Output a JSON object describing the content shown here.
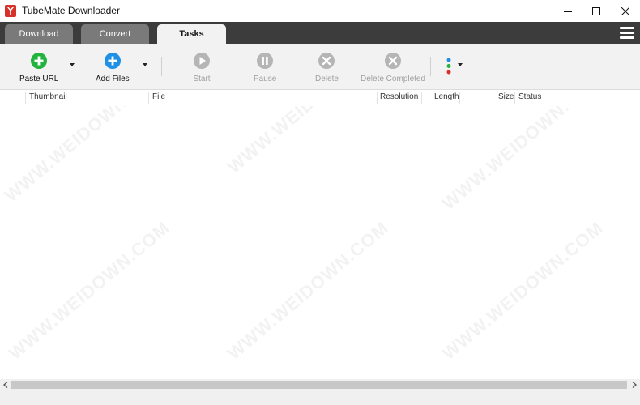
{
  "window": {
    "title": "TubeMate Downloader",
    "controls": {
      "minimize": "minimize-icon",
      "maximize": "maximize-icon",
      "close": "close-icon"
    }
  },
  "tabs": [
    {
      "label": "Download",
      "active": false
    },
    {
      "label": "Convert",
      "active": false
    },
    {
      "label": "Tasks",
      "active": true
    }
  ],
  "toolbar": {
    "paste_url": "Paste URL",
    "add_files": "Add Files",
    "start": "Start",
    "pause": "Pause",
    "delete": "Delete",
    "delete_completed": "Delete Completed"
  },
  "columns": [
    "Thumbnail",
    "File",
    "Resolution",
    "Length",
    "Size",
    "Status"
  ],
  "rows": [],
  "colors": {
    "titlebar": "#ffffff",
    "tabstrip": "#3c3c3c",
    "tab_inactive": "#7a7a7a",
    "tab_active": "#f2f2f2",
    "paste_green": "#21b33c",
    "add_blue": "#1e90e6",
    "disabled_gray": "#b5b5b5",
    "brand_red": "#d6322b"
  },
  "watermark": "WWW.WEIDOWN.COM"
}
